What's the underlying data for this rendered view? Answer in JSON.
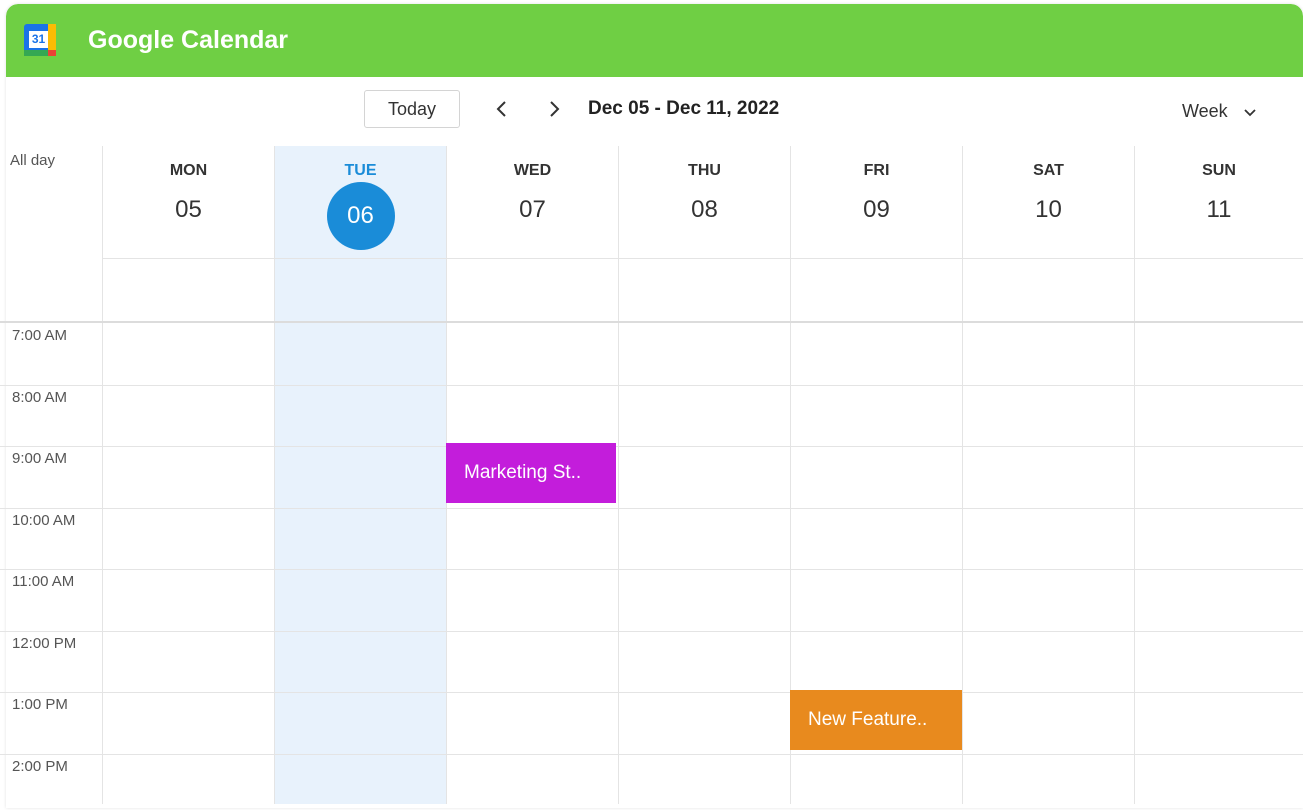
{
  "app": {
    "title": "Google Calendar",
    "logo_text": "31"
  },
  "toolbar": {
    "today_label": "Today",
    "prev_icon": "chevron-left-icon",
    "next_icon": "chevron-right-icon",
    "date_range": "Dec 05 - Dec 11, 2022",
    "view_label": "Week",
    "view_icon": "chevron-down-icon"
  },
  "grid": {
    "allday_label": "All day",
    "days": [
      {
        "name": "MON",
        "num": "05",
        "today": false
      },
      {
        "name": "TUE",
        "num": "06",
        "today": true
      },
      {
        "name": "WED",
        "num": "07",
        "today": false
      },
      {
        "name": "THU",
        "num": "08",
        "today": false
      },
      {
        "name": "FRI",
        "num": "09",
        "today": false
      },
      {
        "name": "SAT",
        "num": "10",
        "today": false
      },
      {
        "name": "SUN",
        "num": "11",
        "today": false
      }
    ],
    "times": [
      "7:00 AM",
      "8:00 AM",
      "9:00 AM",
      "10:00 AM",
      "11:00 AM",
      "12:00 PM",
      "1:00 PM",
      "2:00 PM"
    ]
  },
  "events": [
    {
      "title": "Marketing St..",
      "day": "WED",
      "start": "9:00 AM",
      "color": "#c31ddb"
    },
    {
      "title": "New Feature..",
      "day": "FRI",
      "start": "1:00 PM",
      "color": "#e88a1e"
    }
  ],
  "colors": {
    "header": "#6fcf44",
    "today_accent": "#1a8cd8",
    "today_column": "#e8f2fc"
  }
}
